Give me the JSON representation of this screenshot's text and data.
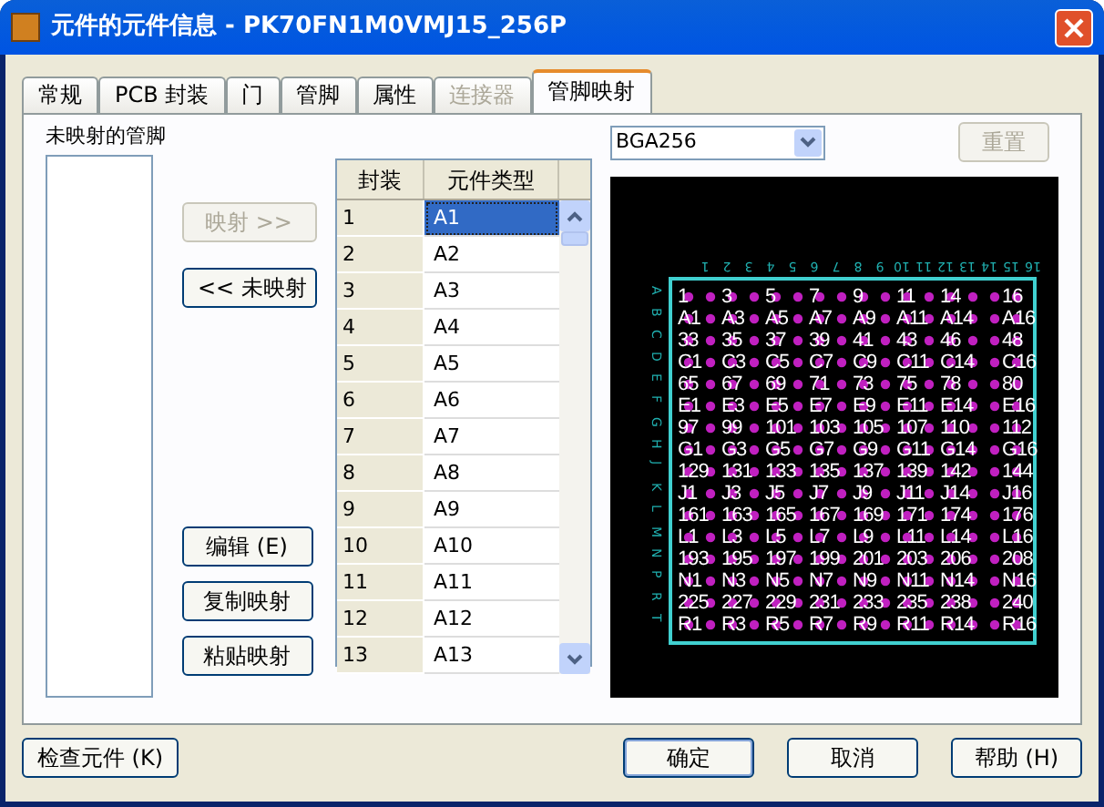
{
  "window": {
    "title": "元件的元件信息 - PK70FN1M0VMJ15_256P"
  },
  "tabs": [
    {
      "label": "常规",
      "selected": false,
      "disabled": false
    },
    {
      "label": "PCB 封装",
      "selected": false,
      "disabled": false
    },
    {
      "label": "门",
      "selected": false,
      "disabled": false
    },
    {
      "label": "管脚",
      "selected": false,
      "disabled": false
    },
    {
      "label": "属性",
      "selected": false,
      "disabled": false
    },
    {
      "label": "连接器",
      "selected": false,
      "disabled": true
    },
    {
      "label": "管脚映射",
      "selected": true,
      "disabled": false
    }
  ],
  "unmapped_pins": {
    "label": "未映射的管脚"
  },
  "side_buttons": [
    {
      "label": "映射 >>",
      "disabled": true
    },
    {
      "label": "<< 未映射",
      "disabled": false
    }
  ],
  "edit_buttons": [
    {
      "label": "编辑 (E)",
      "disabled": false
    },
    {
      "label": "复制映射",
      "disabled": false
    },
    {
      "label": "粘贴映射",
      "disabled": false
    }
  ],
  "table": {
    "columns": [
      "封装",
      "元件类型"
    ],
    "rows": [
      {
        "cells": [
          "1",
          "A1"
        ],
        "selected": true
      },
      {
        "cells": [
          "2",
          "A2"
        ],
        "selected": false
      },
      {
        "cells": [
          "3",
          "A3"
        ],
        "selected": false
      },
      {
        "cells": [
          "4",
          "A4"
        ],
        "selected": false
      },
      {
        "cells": [
          "5",
          "A5"
        ],
        "selected": false
      },
      {
        "cells": [
          "6",
          "A6"
        ],
        "selected": false
      },
      {
        "cells": [
          "7",
          "A7"
        ],
        "selected": false
      },
      {
        "cells": [
          "8",
          "A8"
        ],
        "selected": false
      },
      {
        "cells": [
          "9",
          "A9"
        ],
        "selected": false
      },
      {
        "cells": [
          "10",
          "A10"
        ],
        "selected": false
      },
      {
        "cells": [
          "11",
          "A11"
        ],
        "selected": false
      },
      {
        "cells": [
          "12",
          "A12"
        ],
        "selected": false
      },
      {
        "cells": [
          "13",
          "A13"
        ],
        "selected": false
      }
    ]
  },
  "decal_select": {
    "value": "BGA256"
  },
  "reset_button": {
    "label": "重置",
    "disabled": true
  },
  "preview": {
    "column_numbers": [
      "1",
      "2",
      "3",
      "4",
      "5",
      "6",
      "7",
      "8",
      "9",
      "10",
      "11",
      "12",
      "13",
      "14",
      "15",
      "16"
    ],
    "row_letters": [
      "A",
      "B",
      "C",
      "D",
      "E",
      "F",
      "G",
      "H",
      "J",
      "K",
      "L",
      "M",
      "N",
      "P",
      "R",
      "T"
    ],
    "lines": [
      [
        "1",
        "3",
        "5",
        "7",
        "9",
        "11",
        "14",
        "16"
      ],
      [
        "A1",
        "A3",
        "A5",
        "A7",
        "A9",
        "A11",
        "A14",
        "A16"
      ],
      [
        "33",
        "35",
        "37",
        "39",
        "41",
        "43",
        "46",
        "48"
      ],
      [
        "C1",
        "C3",
        "C5",
        "C7",
        "C9",
        "C11",
        "C14",
        "C16"
      ],
      [
        "65",
        "67",
        "69",
        "71",
        "73",
        "75",
        "78",
        "80"
      ],
      [
        "E1",
        "E3",
        "E5",
        "E7",
        "E9",
        "E11",
        "E14",
        "E16"
      ],
      [
        "97",
        "99",
        "101",
        "103",
        "105",
        "107",
        "110",
        "112"
      ],
      [
        "G1",
        "G3",
        "G5",
        "G7",
        "G9",
        "G11",
        "G14",
        "G16"
      ],
      [
        "129",
        "131",
        "133",
        "135",
        "137",
        "139",
        "142",
        "144"
      ],
      [
        "J1",
        "J3",
        "J5",
        "J7",
        "J9",
        "J11",
        "J14",
        "J16"
      ],
      [
        "161",
        "163",
        "165",
        "167",
        "169",
        "171",
        "174",
        "176"
      ],
      [
        "L1",
        "L3",
        "L5",
        "L7",
        "L9",
        "L11",
        "L14",
        "L16"
      ],
      [
        "193",
        "195",
        "197",
        "199",
        "201",
        "203",
        "206",
        "208"
      ],
      [
        "N1",
        "N3",
        "N5",
        "N7",
        "N9",
        "N11",
        "N14",
        "N16"
      ],
      [
        "225",
        "227",
        "229",
        "231",
        "233",
        "235",
        "238",
        "240"
      ],
      [
        "R1",
        "R3",
        "R5",
        "R7",
        "R9",
        "R11",
        "R14",
        "R16"
      ]
    ]
  },
  "bottom_buttons": [
    {
      "label": "检查元件 (K)",
      "kind": "left",
      "default": false
    },
    {
      "label": "确定",
      "kind": "right",
      "default": true
    },
    {
      "label": "取消",
      "kind": "right",
      "default": false
    },
    {
      "label": "帮助 (H)",
      "kind": "right",
      "default": false
    }
  ]
}
